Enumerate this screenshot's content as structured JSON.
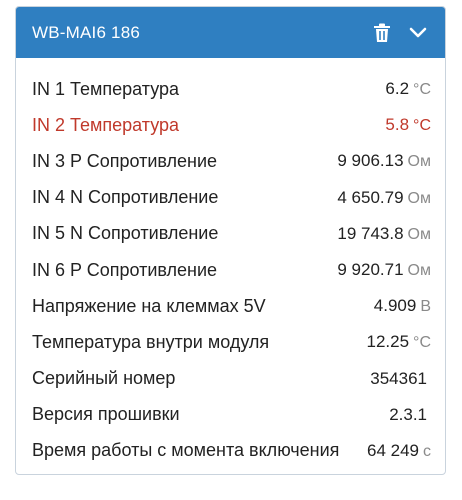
{
  "device": {
    "title": "WB-MAI6 186",
    "icons": {
      "delete": "trash-icon",
      "collapse": "chevron-down-icon"
    },
    "colors": {
      "header": "#2f7fc1",
      "alert": "#c0392b",
      "unit": "#8a8a8a"
    }
  },
  "rows": [
    {
      "label": "IN 1 Температура",
      "value": "6.2",
      "unit": "°C",
      "alert": false
    },
    {
      "label": "IN 2 Температура",
      "value": "5.8",
      "unit": "°C",
      "alert": true
    },
    {
      "label": "IN 3 P Сопротивление",
      "value": "9 906.13",
      "unit": "Ом",
      "alert": false
    },
    {
      "label": "IN 4 N Сопротивление",
      "value": "4 650.79",
      "unit": "Ом",
      "alert": false
    },
    {
      "label": "IN 5 N Сопротивление",
      "value": "19 743.8",
      "unit": "Ом",
      "alert": false
    },
    {
      "label": "IN 6 P Сопротивление",
      "value": "9 920.71",
      "unit": "Ом",
      "alert": false
    },
    {
      "label": "Напряжение на клеммах 5V",
      "value": "4.909",
      "unit": "В",
      "alert": false
    },
    {
      "label": "Температура внутри модуля",
      "value": "12.25",
      "unit": "°C",
      "alert": false
    },
    {
      "label": "Серийный номер",
      "value": "354361",
      "unit": "",
      "alert": false
    },
    {
      "label": "Версия прошивки",
      "value": "2.3.1",
      "unit": "",
      "alert": false
    },
    {
      "label": "Время работы с момента включения",
      "value": "64 249",
      "unit": "с",
      "alert": false
    }
  ]
}
